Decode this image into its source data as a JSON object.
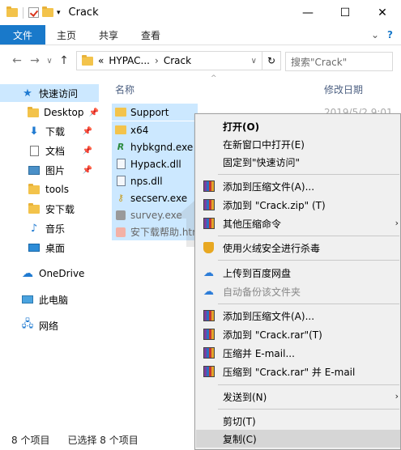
{
  "window": {
    "title": "Crack",
    "minimize": "—",
    "maximize": "☐",
    "close": "✕"
  },
  "ribbon": {
    "tabs": [
      "文件",
      "主页",
      "共享",
      "查看"
    ],
    "expand": "⌄",
    "help": "?"
  },
  "address": {
    "back": "←",
    "forward": "→",
    "recent": "∨",
    "up": "↑",
    "path_prefix": "«",
    "seg1": "HYPAC...",
    "sep": "›",
    "seg2": "Crack",
    "dropdown": "∨",
    "refresh": "↻",
    "search_placeholder": "搜索\"Crack\""
  },
  "sidebar": {
    "quick_access": "快速访问",
    "items": [
      {
        "label": "Desktop",
        "pinned": true
      },
      {
        "label": "下载",
        "pinned": true
      },
      {
        "label": "文档",
        "pinned": true
      },
      {
        "label": "图片",
        "pinned": true
      },
      {
        "label": "tools",
        "pinned": false
      },
      {
        "label": "安下载",
        "pinned": false
      },
      {
        "label": "音乐",
        "pinned": false
      },
      {
        "label": "桌面",
        "pinned": false
      }
    ],
    "onedrive": "OneDrive",
    "this_pc": "此电脑",
    "network": "网络",
    "pin_glyph": "📌"
  },
  "columns": {
    "name": "名称",
    "modified": "修改日期",
    "sort_glyph": "^"
  },
  "files": [
    {
      "name": "Support",
      "type": "folder",
      "date": "2019/5/2 9:01"
    },
    {
      "name": "x64",
      "type": "folder"
    },
    {
      "name": "hybkgnd.exe",
      "type": "exe"
    },
    {
      "name": "Hypack.dll",
      "type": "dll"
    },
    {
      "name": "nps.dll",
      "type": "dll"
    },
    {
      "name": "secserv.exe",
      "type": "key"
    },
    {
      "name": "survey.exe",
      "type": "img"
    },
    {
      "name": "安下载帮助.htm",
      "type": "htm"
    }
  ],
  "status": {
    "count": "8 个项目",
    "selected": "已选择 8 个项目"
  },
  "context_menu": {
    "open": "打开(O)",
    "open_new_window": "在新窗口中打开(E)",
    "pin_quick": "固定到\"快速访问\"",
    "add_archive": "添加到压缩文件(A)...",
    "add_zip": "添加到 \"Crack.zip\" (T)",
    "other_compress": "其他压缩命令",
    "scan": "使用火绒安全进行杀毒",
    "upload_baidu": "上传到百度网盘",
    "auto_backup": "自动备份该文件夹",
    "add_archive2": "添加到压缩文件(A)...",
    "add_rar": "添加到 \"Crack.rar\"(T)",
    "compress_email": "压缩并 E-mail...",
    "compress_rar_email": "压缩到 \"Crack.rar\" 并 E-mail",
    "send_to": "发送到(N)",
    "cut": "剪切(T)",
    "copy": "复制(C)",
    "arrow": "›"
  },
  "watermark": {
    "text": "安下载"
  }
}
